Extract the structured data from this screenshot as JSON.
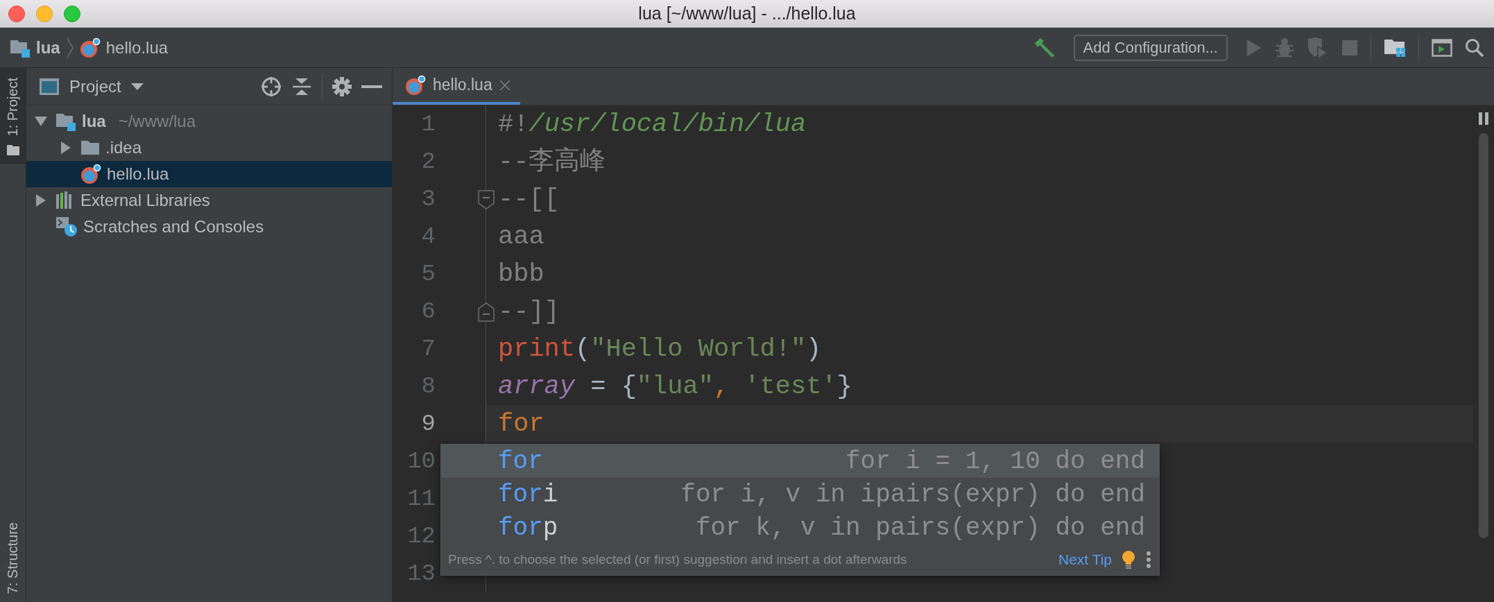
{
  "window": {
    "title": "lua [~/www/lua] - .../hello.lua"
  },
  "navbar": {
    "breadcrumbs": [
      {
        "kind": "module",
        "label": "lua"
      },
      {
        "kind": "lua",
        "label": "hello.lua"
      }
    ],
    "actions": [
      {
        "kind": "build",
        "disabled": false
      },
      {
        "kind": "configuration",
        "label": "Add Configuration..."
      },
      {
        "kind": "run",
        "disabled": true
      },
      {
        "kind": "debug",
        "disabled": true
      },
      {
        "kind": "coverage",
        "disabled": true
      },
      {
        "kind": "stop",
        "disabled": true
      },
      {
        "kind": "project_structure",
        "disabled": false
      },
      {
        "kind": "terminal",
        "disabled": false
      },
      {
        "kind": "search",
        "disabled": false
      }
    ]
  },
  "tool_strip": {
    "top": [
      {
        "label": "1: Project",
        "selected": true
      }
    ],
    "bottom": [
      {
        "label": "7: Structure",
        "selected": false
      }
    ]
  },
  "project_panel": {
    "title": "Project",
    "tree": [
      {
        "kind": "module",
        "label": "lua",
        "hint": "~/www/lua",
        "expanded": true,
        "selected": false,
        "children": [
          {
            "kind": "folder",
            "label": ".idea",
            "expanded": false,
            "selected": false
          },
          {
            "kind": "lua",
            "label": "hello.lua",
            "selected": true
          }
        ]
      },
      {
        "kind": "libraries",
        "label": "External Libraries",
        "expanded": false,
        "selected": false
      },
      {
        "kind": "scratches",
        "label": "Scratches and Consoles",
        "selected": false
      }
    ]
  },
  "editor": {
    "tabs": [
      {
        "label": "hello.lua",
        "selected": true
      }
    ],
    "lines": [
      {
        "kind": "code",
        "number": "1",
        "current": false,
        "tokens": [
          {
            "kind": "comment",
            "text": "#!"
          },
          {
            "kind": "path",
            "text": "/usr/local/bin/lua"
          }
        ]
      },
      {
        "kind": "code",
        "number": "2",
        "current": false,
        "tokens": [
          {
            "kind": "comment",
            "text": "--李高峰"
          }
        ]
      },
      {
        "kind": "fold_start",
        "number": "3",
        "current": false,
        "tokens": [
          {
            "kind": "comment",
            "text": "--[["
          }
        ]
      },
      {
        "kind": "code",
        "number": "4",
        "current": false,
        "tokens": [
          {
            "kind": "comment",
            "text": "aaa"
          }
        ]
      },
      {
        "kind": "code",
        "number": "5",
        "current": false,
        "tokens": [
          {
            "kind": "comment",
            "text": "bbb"
          }
        ]
      },
      {
        "kind": "fold_end",
        "number": "6",
        "current": false,
        "tokens": [
          {
            "kind": "comment",
            "text": "--]]"
          }
        ]
      },
      {
        "kind": "code",
        "number": "7",
        "current": false,
        "tokens": [
          {
            "kind": "function",
            "text": "print"
          },
          {
            "kind": "punct",
            "text": "("
          },
          {
            "kind": "string",
            "text": "\"Hello World!\""
          },
          {
            "kind": "punct",
            "text": ")"
          }
        ]
      },
      {
        "kind": "code",
        "number": "8",
        "current": false,
        "tokens": [
          {
            "kind": "variable",
            "text": "array"
          },
          {
            "kind": "punct",
            "text": " = {"
          },
          {
            "kind": "string",
            "text": "\"lua\""
          },
          {
            "kind": "keyword",
            "text": ","
          },
          {
            "kind": "string",
            "text": " 'test'"
          },
          {
            "kind": "punct",
            "text": "}"
          }
        ]
      },
      {
        "kind": "code",
        "number": "9",
        "current": true,
        "tokens": [
          {
            "kind": "keyword",
            "text": "for"
          }
        ]
      },
      {
        "kind": "code",
        "number": "10",
        "current": false
      },
      {
        "kind": "code",
        "number": "11",
        "current": false
      },
      {
        "kind": "code",
        "number": "12",
        "current": false
      },
      {
        "kind": "code",
        "number": "13",
        "current": false
      }
    ],
    "completion": {
      "items": [
        {
          "match": "for",
          "description": "for i = 1, 10 do end",
          "selected": true
        },
        {
          "match": "for",
          "rest": "i",
          "description": "for i, v in ipairs(expr) do end",
          "selected": false
        },
        {
          "match": "for",
          "rest": "p",
          "description": "for k, v in pairs(expr) do end",
          "selected": false
        }
      ],
      "hint": "Press ^. to choose the selected (or first) suggestion and insert a dot afterwards",
      "link": "Next Tip"
    }
  }
}
